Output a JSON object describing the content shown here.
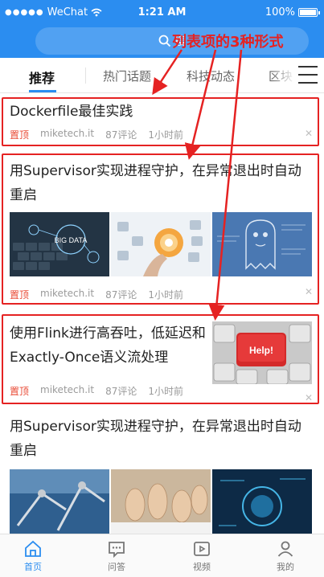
{
  "status_bar": {
    "carrier": "WeChat",
    "time": "1:21 AM",
    "battery": "100%"
  },
  "search": {
    "placeholder_partial": "搜"
  },
  "annotation": "列表项的3种形式",
  "tabs": [
    {
      "label": "推荐"
    },
    {
      "label": "热门话题"
    },
    {
      "label": "科技动态"
    },
    {
      "label": "区块"
    }
  ],
  "feed": [
    {
      "title": "Dockerfile最佳实践",
      "tag": "置顶",
      "source": "miketech.it",
      "comments": "87评论",
      "time": "1小时前"
    },
    {
      "title": "用Supervisor实现进程守护，在异常退出时自动重启",
      "tag": "置顶",
      "source": "miketech.it",
      "comments": "87评论",
      "time": "1小时前"
    },
    {
      "title": "使用Flink进行高吞吐，低延迟和Exactly-Once语义流处理",
      "tag": "置顶",
      "source": "miketech.it",
      "comments": "87评论",
      "time": "1小时前",
      "thumb_text": "Help!"
    },
    {
      "title": "用Supervisor实现进程守护，在异常退出时自动重启"
    }
  ],
  "bottom_nav": [
    {
      "label": "首页",
      "icon": "home-icon",
      "active": true
    },
    {
      "label": "问答",
      "icon": "qa-icon",
      "active": false
    },
    {
      "label": "视频",
      "icon": "video-icon",
      "active": false
    },
    {
      "label": "我的",
      "icon": "user-icon",
      "active": false
    }
  ],
  "colors": {
    "accent": "#2b8df0",
    "highlight_box": "#e52222",
    "pinned_tag": "#e94b36"
  }
}
